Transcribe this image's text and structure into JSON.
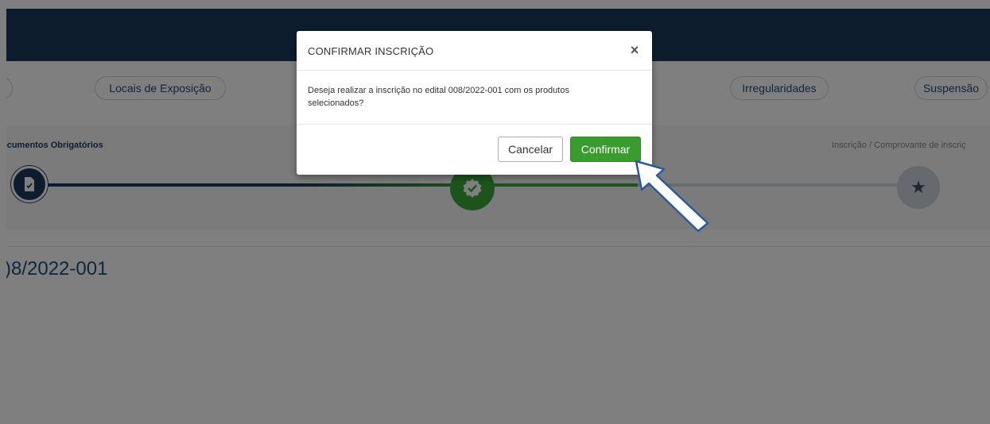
{
  "pills": {
    "locais": "Locais de Exposição",
    "irregularidades": "Irregularidades",
    "suspensao": "Suspensão"
  },
  "stepper": {
    "step1_label": "ocumentos Obrigatórios",
    "step3_label": "Inscrição / Comprovante de inscriç"
  },
  "content": {
    "edital_title": ")8/2022-001"
  },
  "modal": {
    "title": "CONFIRMAR INSCRIÇÃO",
    "close": "×",
    "message": "Deseja realizar a inscrição no edital 008/2022-001 com os produtos selecionados?",
    "cancel_label": "Cancelar",
    "confirm_label": "Confirmar"
  },
  "colors": {
    "navbar": "#1b3a5c",
    "confirm_button": "#3a9b2e",
    "step_active": "#3aa63a"
  }
}
